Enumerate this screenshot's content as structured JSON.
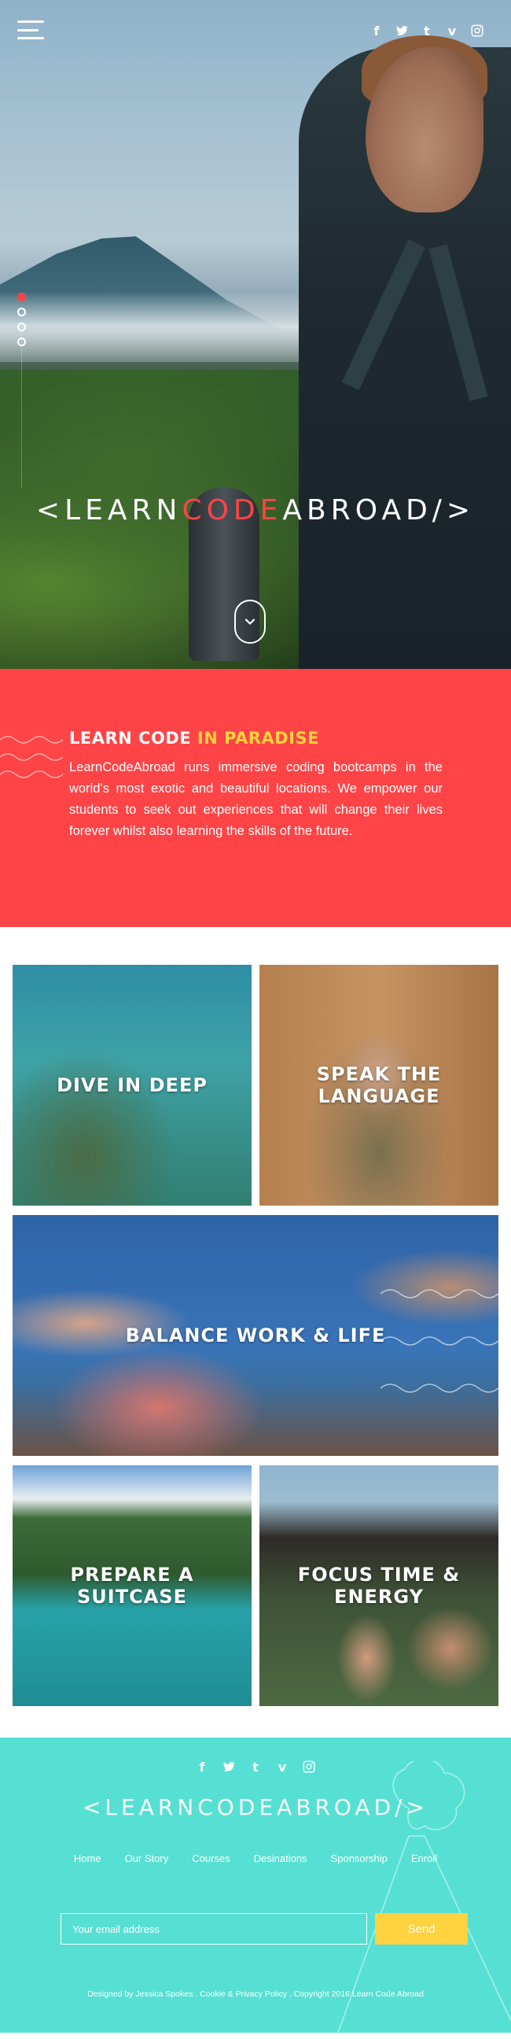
{
  "hero": {
    "logo_prefix": "<LEARN",
    "logo_highlight": "CODE",
    "logo_suffix": "ABROAD/>",
    "socials": [
      "facebook-icon",
      "twitter-icon",
      "tumblr-icon",
      "vimeo-icon",
      "instagram-icon"
    ],
    "slides": 4,
    "active_slide": 1
  },
  "intro": {
    "title_prefix": "LEARN CODE ",
    "title_highlight": "IN PARADISE",
    "body": "LearnCodeAbroad runs immersive coding bootcamps in the world's most exotic and beautiful locations. We empower our students to seek out experiences that will change their lives forever whilst also learning the skills of the future."
  },
  "tiles": [
    {
      "label": "DIVE IN DEEP"
    },
    {
      "label": "SPEAK THE LANGUAGE"
    },
    {
      "label": "BALANCE WORK & LIFE"
    },
    {
      "label": "PREPARE A SUITCASE"
    },
    {
      "label": "FOCUS TIME & ENERGY"
    }
  ],
  "footer": {
    "logo": "<LEARNCODEABROAD/>",
    "nav": [
      "Home",
      "Our Story",
      "Courses",
      "Desinations",
      "Sponsorship",
      "Enroll"
    ],
    "email_placeholder": "Your email address",
    "send_label": "Send",
    "credit": "Designed by Jessica Spokes . Cookie & Privacy Policy . Copyright 2016 Learn Code Abroad"
  },
  "colors": {
    "accent_red": "#fe4446",
    "accent_yellow": "#ffd23f",
    "footer_teal": "#56e0d3"
  }
}
